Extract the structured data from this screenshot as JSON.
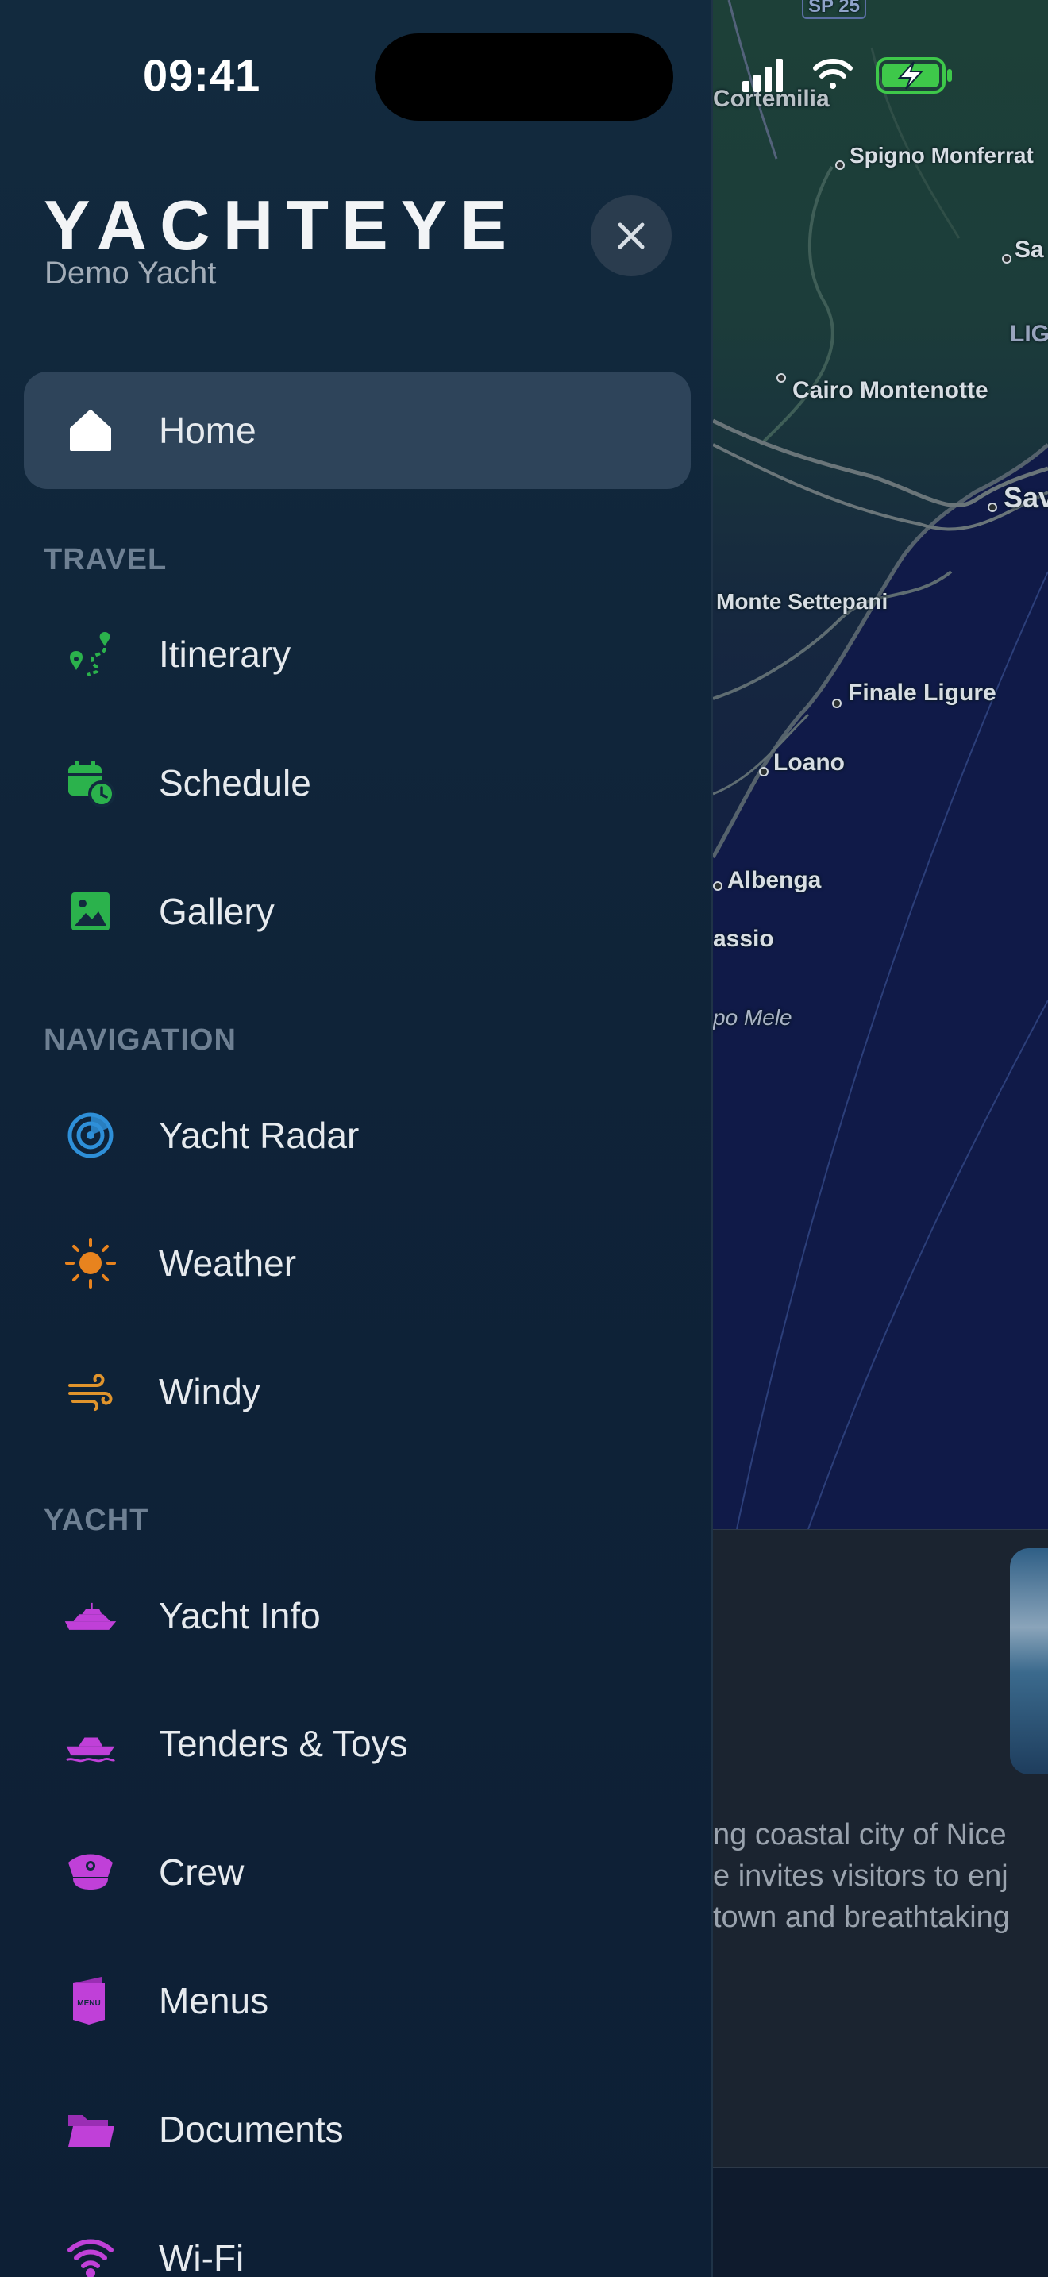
{
  "status_bar": {
    "time": "09:41"
  },
  "brand": {
    "name": "YACHTEYE",
    "subtitle": "Demo Yacht"
  },
  "menu": {
    "home": {
      "label": "Home",
      "icon": "home-icon"
    },
    "sections": {
      "travel": {
        "heading": "TRAVEL",
        "items": [
          {
            "label": "Itinerary",
            "icon": "route-pin-icon",
            "color": "#2bb24c"
          },
          {
            "label": "Schedule",
            "icon": "calendar-clock-icon",
            "color": "#2bb24c"
          },
          {
            "label": "Gallery",
            "icon": "image-icon",
            "color": "#2bb24c"
          }
        ]
      },
      "navigation": {
        "heading": "NAVIGATION",
        "items": [
          {
            "label": "Yacht Radar",
            "icon": "radar-icon",
            "color": "#2e8fd8"
          },
          {
            "label": "Weather",
            "icon": "sun-icon",
            "color": "#e8831e"
          },
          {
            "label": "Windy",
            "icon": "wind-icon",
            "color": "#e0942c"
          }
        ]
      },
      "yacht": {
        "heading": "YACHT",
        "items": [
          {
            "label": "Yacht Info",
            "icon": "yacht-icon",
            "color": "#c040d8"
          },
          {
            "label": "Tenders & Toys",
            "icon": "tender-boat-icon",
            "color": "#c040d8"
          },
          {
            "label": "Crew",
            "icon": "captain-hat-icon",
            "color": "#c040d8"
          },
          {
            "label": "Menus",
            "icon": "menu-card-icon",
            "color": "#c040d8"
          },
          {
            "label": "Documents",
            "icon": "folder-icon",
            "color": "#c040d8"
          },
          {
            "label": "Wi-Fi",
            "icon": "wifi-icon",
            "color": "#c040d8"
          }
        ]
      }
    }
  },
  "menu_card_text": "MENU",
  "background": {
    "map_labels": {
      "sp": "SP 25",
      "cortemilia": "Cortemilia",
      "spigno": "Spigno Monferrat",
      "sa": "Sa",
      "lig": "LIG",
      "cairo": "Cairo Montenotte",
      "sav": "Sav",
      "settepani": "Monte Settepani",
      "finale": "Finale Ligure",
      "loano": "Loano",
      "albenga": "Albenga",
      "assio": "assio",
      "mele": "po Mele"
    },
    "card_text_lines": [
      "ng coastal city of Nice",
      "e invites visitors to enj",
      "town and breathtaking"
    ]
  },
  "colors": {
    "drawer_bg": "#0f2338",
    "active_item_bg": "#2e445a",
    "battery_green": "#3ec84a"
  }
}
